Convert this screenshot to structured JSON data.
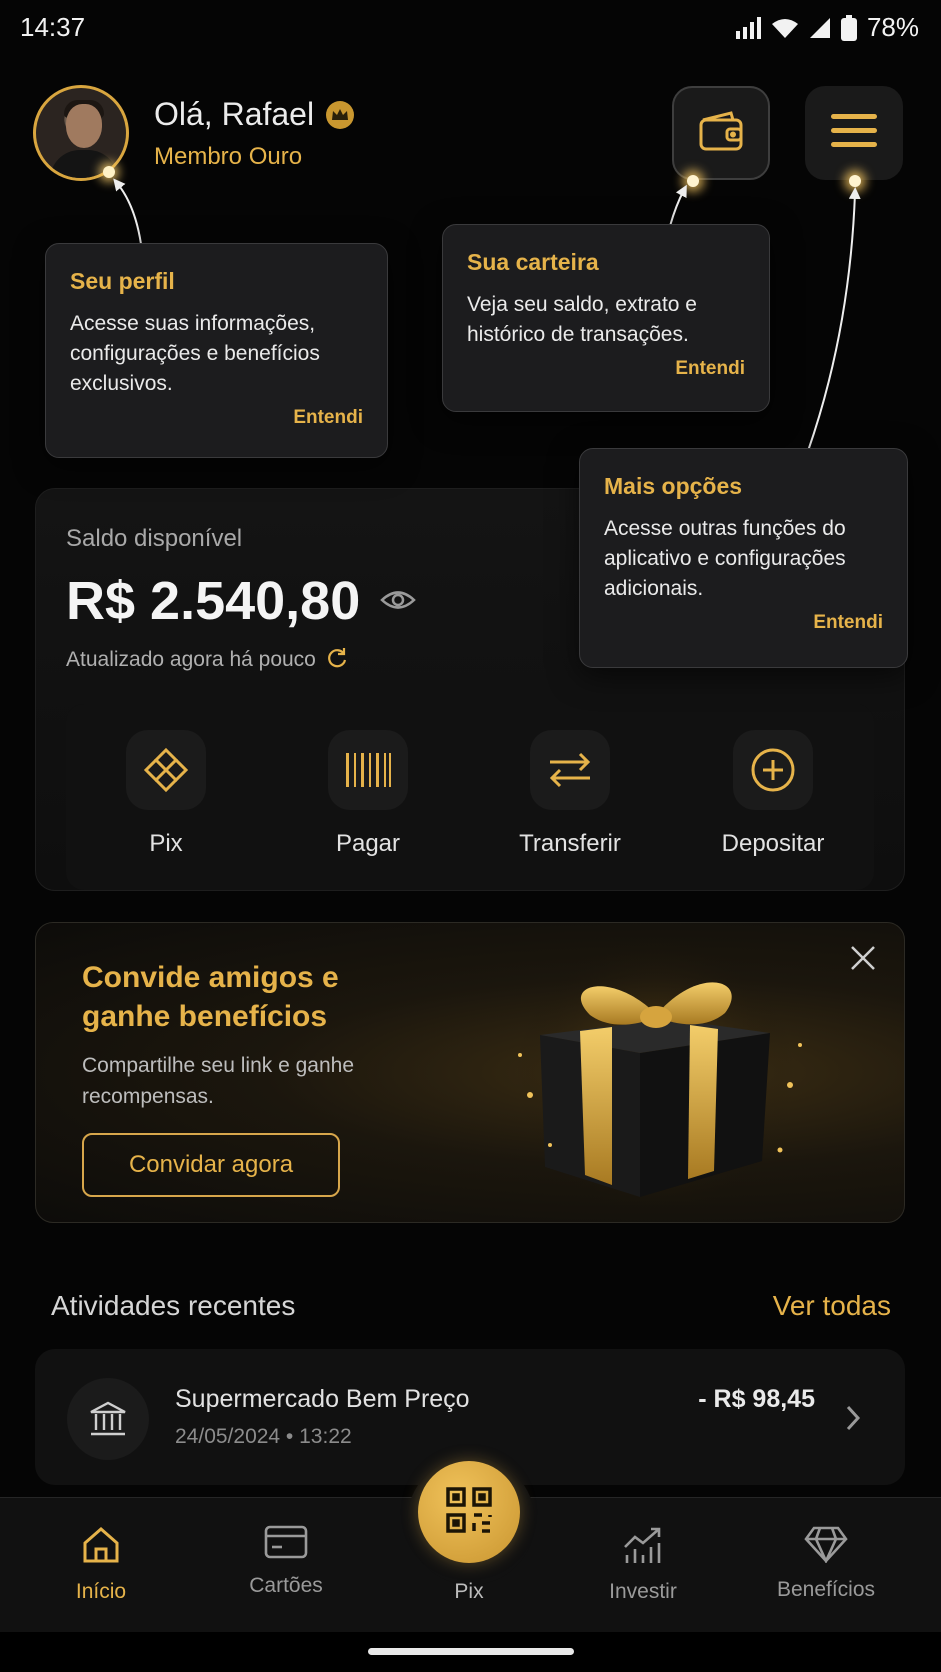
{
  "status": {
    "time": "14:37",
    "battery": "78%"
  },
  "header": {
    "greeting": "Olá, Rafael",
    "member": "Membro Ouro"
  },
  "tooltips": {
    "profile": {
      "title": "Seu perfil",
      "body": "Acesse suas informações, configurações e benefícios exclusivos.",
      "ok": "Entendi"
    },
    "wallet": {
      "title": "Sua carteira",
      "body": "Veja seu saldo, extrato e histórico de transações.",
      "ok": "Entendi"
    },
    "more": {
      "title": "Mais opções",
      "body": "Acesse outras funções do aplicativo e configurações adicionais.",
      "ok": "Entendi"
    }
  },
  "balance": {
    "label": "Saldo disponível",
    "value": "R$ 2.540,80",
    "updated": "Atualizado agora há pouco"
  },
  "actions": [
    {
      "label": "Pix",
      "icon": "pix-icon"
    },
    {
      "label": "Pagar",
      "icon": "barcode-icon"
    },
    {
      "label": "Transferir",
      "icon": "transfer-icon"
    },
    {
      "label": "Depositar",
      "icon": "plus-circle-icon"
    }
  ],
  "promo": {
    "title": "Convide amigos e ganhe benefícios",
    "subtitle": "Compartilhe seu link e ganhe recompensas.",
    "button": "Convidar agora"
  },
  "activities": {
    "title": "Atividades recentes",
    "see_all": "Ver todas",
    "items": [
      {
        "name": "Supermercado Bem Preço",
        "date": "24/05/2024 • 13:22",
        "amount": "- R$ 98,45"
      }
    ]
  },
  "nav": {
    "home": "Início",
    "cards": "Cartões",
    "pix": "Pix",
    "invest": "Investir",
    "benefits": "Benefícios"
  },
  "colors": {
    "accent": "#e6b34a",
    "background": "#050505",
    "card": "#111111"
  }
}
